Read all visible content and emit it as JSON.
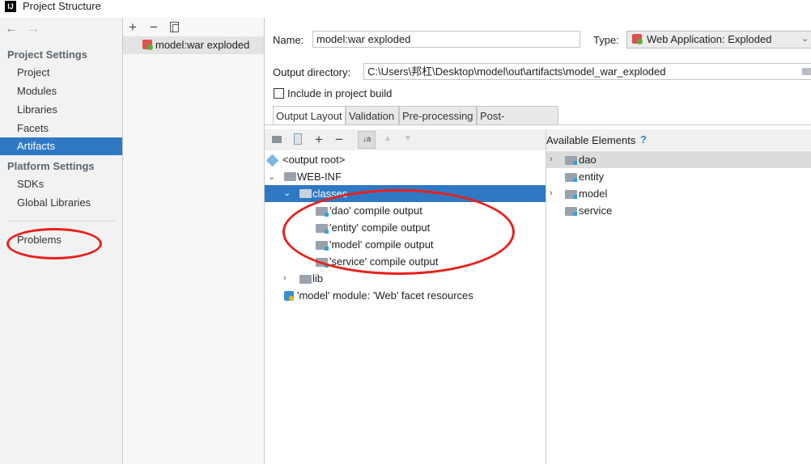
{
  "window": {
    "title": "Project Structure",
    "app_icon": "IJ"
  },
  "nav": {
    "back_icon": "arrow-left-icon",
    "forward_icon": "arrow-right-icon",
    "project_settings_header": "Project Settings",
    "project_settings_items": [
      "Project",
      "Modules",
      "Libraries",
      "Facets",
      "Artifacts"
    ],
    "selected_item": "Artifacts",
    "platform_settings_header": "Platform Settings",
    "platform_settings_items": [
      "SDKs",
      "Global Libraries"
    ],
    "problems": "Problems"
  },
  "artifact_list": {
    "toolbar": {
      "add": "+",
      "remove": "−",
      "copy_icon": "copy-icon"
    },
    "items": [
      "model:war exploded"
    ]
  },
  "artifact": {
    "name_label": "Name:",
    "name_value": "model:war exploded",
    "type_label": "Type:",
    "type_value": "Web Application: Exploded",
    "output_dir_label": "Output directory:",
    "output_dir_value": "C:\\Users\\邦杠\\Desktop\\model\\out\\artifacts\\model_war_exploded",
    "include_label": "Include in project build",
    "include_checked": false
  },
  "tabs": [
    "Output Layout",
    "Validation",
    "Pre-processing",
    "Post-processing"
  ],
  "active_tab": "Output Layout",
  "layout_tree": {
    "root": "<output root>",
    "web_inf": "WEB-INF",
    "classes": "classes",
    "classes_children": [
      "'dao' compile output",
      "'entity' compile output",
      "'model' compile output",
      "'service' compile output"
    ],
    "lib": "lib",
    "facet": "'model' module: 'Web' facet resources"
  },
  "available": {
    "header": "Available Elements",
    "help": "?",
    "items": [
      "dao",
      "entity",
      "model",
      "service"
    ],
    "selected": "dao"
  },
  "colors": {
    "selection": "#2f78c4",
    "annotation_red": "#e8201b",
    "nav_bg": "#f2f2f2"
  }
}
